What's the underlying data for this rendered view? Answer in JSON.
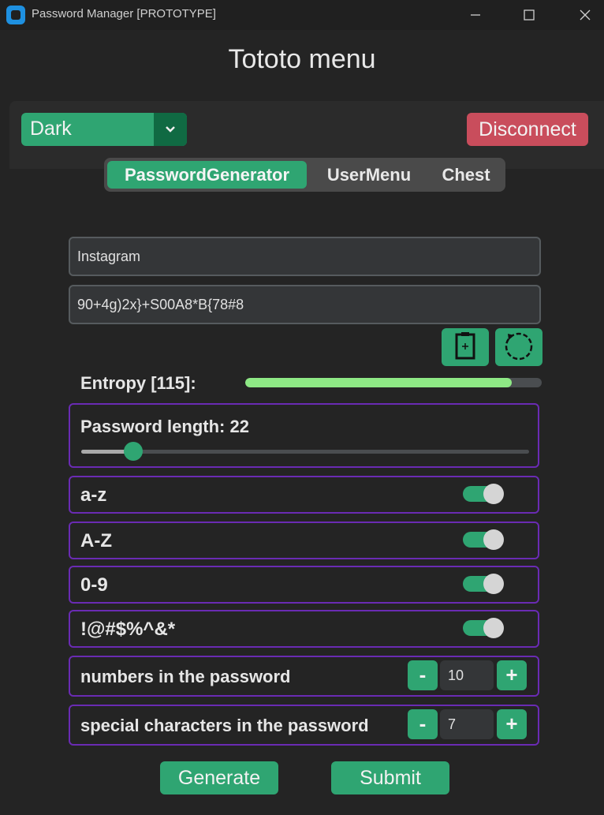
{
  "window": {
    "title": "Password Manager [PROTOTYPE]",
    "controls": [
      "minimize",
      "maximize",
      "close"
    ]
  },
  "menu_title": "Tototo menu",
  "theme_select": {
    "value": "Dark"
  },
  "disconnect_label": "Disconnect",
  "tabs": [
    {
      "label": "PasswordGenerator",
      "active": true
    },
    {
      "label": "UserMenu",
      "active": false
    },
    {
      "label": "Chest",
      "active": false
    }
  ],
  "site_field": {
    "value": "Instagram"
  },
  "password_field": {
    "value": "90+4g)2x}+S00A8*B{78#8"
  },
  "icons": {
    "copy": "clipboard-add-icon",
    "regenerate": "refresh-icon"
  },
  "entropy": {
    "label": "Entropy [115]:",
    "value": 115,
    "fill_fraction": 0.9
  },
  "password_length": {
    "label": "Password length: 22",
    "value": 22,
    "min": 8,
    "max": 128
  },
  "char_sets": [
    {
      "label": "a-z",
      "enabled": true
    },
    {
      "label": "A-Z",
      "enabled": true
    },
    {
      "label": "0-9",
      "enabled": true
    },
    {
      "label": "!@#$%^&*",
      "enabled": true
    }
  ],
  "steppers": [
    {
      "label": "numbers in the password",
      "minus": "-",
      "value": "10",
      "plus": "+"
    },
    {
      "label": "special characters in the password",
      "minus": "-",
      "value": "7",
      "plus": "+"
    }
  ],
  "actions": {
    "generate": "Generate",
    "submit": "Submit"
  },
  "colors": {
    "accent": "#2fa572",
    "danger": "#c94d5c",
    "frame_border": "#6a2bb3",
    "entropy_fill": "#8ee885",
    "background": "#242424"
  }
}
